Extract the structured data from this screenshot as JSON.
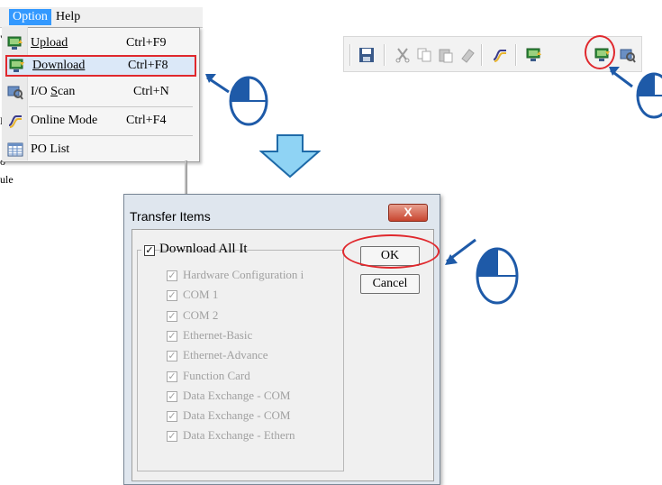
{
  "menubar": {
    "option": "Option",
    "help": "Help"
  },
  "menu_items": [
    {
      "label": "Upload",
      "shortcut": "Ctrl+F9",
      "icon": "upload-icon"
    },
    {
      "label": "Download",
      "shortcut": "Ctrl+F8",
      "icon": "download-icon"
    },
    {
      "label": "I/O Scan",
      "shortcut": "Ctrl+N",
      "icon": "io-scan-icon"
    },
    {
      "label": "Online Mode",
      "shortcut": "Ctrl+F4",
      "icon": "online-mode-icon"
    },
    {
      "label": "PO List",
      "shortcut": "",
      "icon": "po-list-icon"
    }
  ],
  "background_fragments": [
    "ule",
    "o",
    "M",
    "\""
  ],
  "toolbar": {
    "icons": [
      "save-icon",
      "cut-icon",
      "copy-icon",
      "paste-icon",
      "eraser-icon",
      "online-mode-icon",
      "upload-icon",
      "download-icon",
      "io-scan-icon"
    ]
  },
  "dialog": {
    "title": "Transfer Items",
    "close": "X",
    "main_checkbox_label": "Download All It",
    "ok_label": "OK",
    "cancel_label": "Cancel",
    "items": [
      "Hardware Configuration i",
      "COM 1",
      "COM 2",
      "Ethernet-Basic",
      "Ethernet-Advance",
      "Function Card",
      "Data Exchange - COM",
      "Data Exchange - COM",
      "Data Exchange - Ethern"
    ]
  },
  "colors": {
    "highlight": "#e0282d",
    "menu_selected": "#3399ff",
    "arrow": "#8fd3f4",
    "pointer": "#1e5aa8"
  }
}
